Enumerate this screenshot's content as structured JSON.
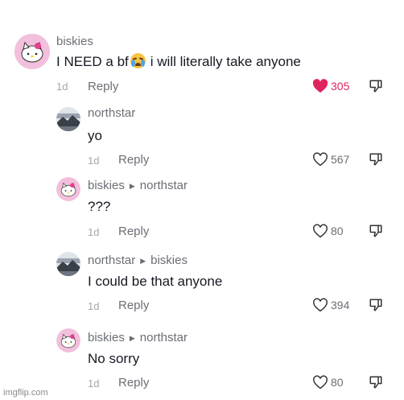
{
  "comments": [
    {
      "username": "biskies",
      "reply_to": "",
      "text_before": "I NEED a bf",
      "emoji": "loudly-crying-face",
      "text_after": "i will literally take anyone",
      "time": "1d",
      "reply_label": "Reply",
      "likes": "305",
      "liked": true,
      "avatar": "hello-kitty"
    },
    {
      "username": "northstar",
      "reply_to": "",
      "text": "yo",
      "time": "1d",
      "reply_label": "Reply",
      "likes": "567",
      "liked": false,
      "avatar": "landscape"
    },
    {
      "username": "biskies",
      "reply_to": "northstar",
      "text": "???",
      "time": "1d",
      "reply_label": "Reply",
      "likes": "80",
      "liked": false,
      "avatar": "hello-kitty"
    },
    {
      "username": "northstar",
      "reply_to": "biskies",
      "text": "I could be that anyone",
      "time": "1d",
      "reply_label": "Reply",
      "likes": "394",
      "liked": false,
      "avatar": "landscape"
    },
    {
      "username": "biskies",
      "reply_to": "northstar",
      "text": "No sorry",
      "time": "1d",
      "reply_label": "Reply",
      "likes": "80",
      "liked": false,
      "avatar": "hello-kitty"
    }
  ],
  "watermark": "imgflip.com",
  "colors": {
    "like_active": "#e0245e",
    "text_primary": "#161823",
    "text_secondary": "#6b6e75"
  }
}
